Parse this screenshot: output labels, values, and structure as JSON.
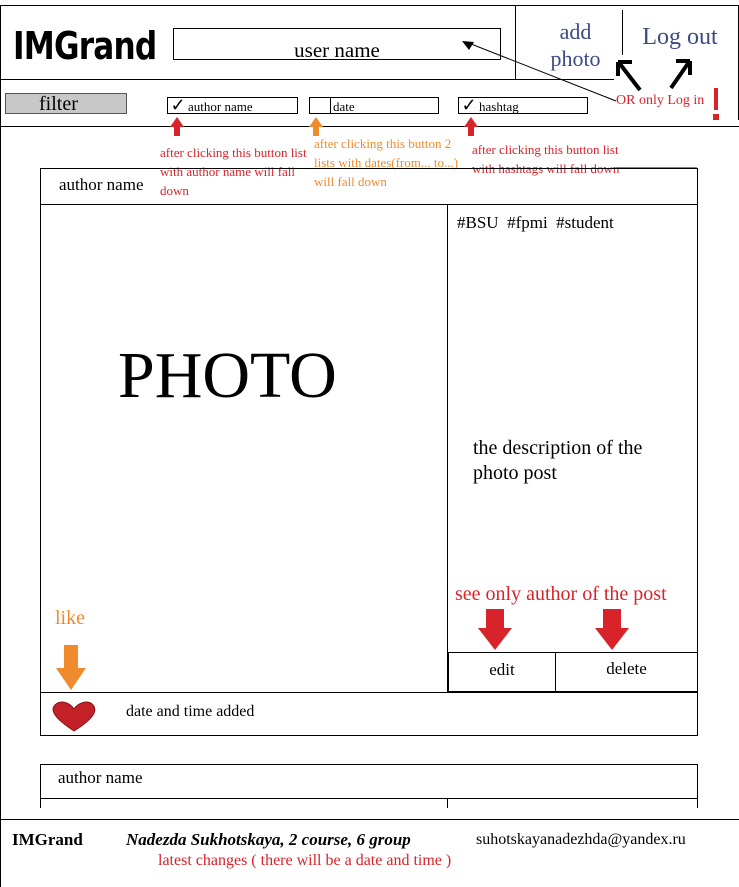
{
  "header": {
    "logo": "IMGrand",
    "user_name": "user name",
    "add_photo": "add photo",
    "logout": "Log out",
    "or_login_note": "OR only Log in"
  },
  "filters": {
    "filter_label": "filter",
    "author": {
      "label": "author name",
      "checked": true
    },
    "date": {
      "label": "date",
      "checked": false
    },
    "hashtag": {
      "label": "hashtag",
      "checked": true
    },
    "notes": {
      "author": "after clicking this button list with author name will fall down",
      "date": "after clicking this button 2 lists with dates(from... to...) will fall down",
      "hashtag": "after clicking this button list with hashtags will fall down"
    }
  },
  "post": {
    "author": "author name",
    "photo_placeholder": "PHOTO",
    "hashtags": "#BSU  #fpmi  #student",
    "description": "the description of the photo post",
    "see_only_note": "see only author of the post",
    "edit_label": "edit",
    "delete_label": "delete",
    "like_label": "like",
    "date_added": "date and time added"
  },
  "post2": {
    "author": "author name"
  },
  "footer": {
    "brand": "IMGrand",
    "author_info": "Nadezda Sukhotskaya, 2 course, 6 group",
    "email": "suhotskayanadezhda@yandex.ru",
    "latest_changes": "latest changes ( there will be a date and time )"
  },
  "colors": {
    "note_red": "#d8232a",
    "note_orange": "#ef8b2c",
    "header_blue": "#3b4a86",
    "filter_gray": "#c8c8c8"
  }
}
